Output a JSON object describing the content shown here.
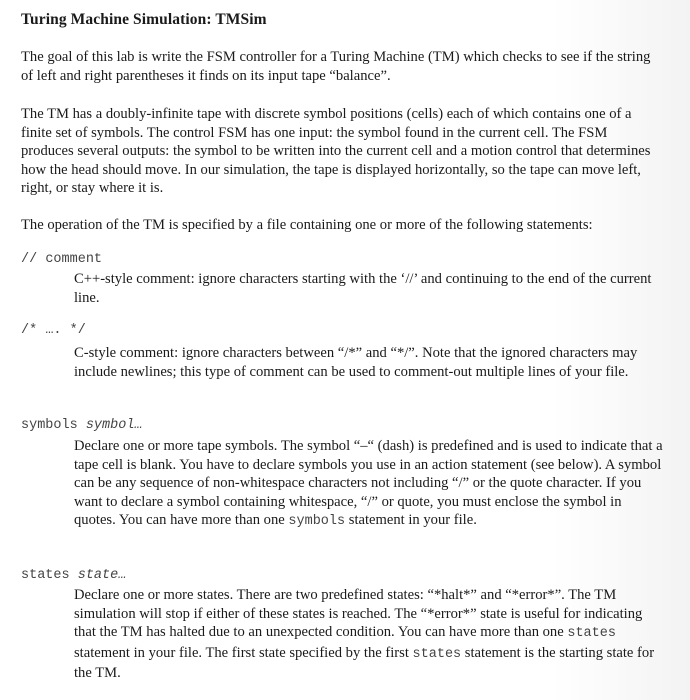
{
  "title": "Turing Machine Simulation: TMSim",
  "intro": "The goal of this lab is write the FSM controller for a Turing Machine (TM) which checks to see if the string of left and right parentheses it finds on its input tape “balance”.",
  "tape_paragraph": "The TM has a doubly-infinite tape with discrete symbol positions (cells) each of which contains one of a finite set of symbols.   The control FSM has one input: the symbol found in the current cell.  The FSM produces several outputs: the symbol to be written into the current cell and a motion control that determines how the head should move.  In our simulation, the tape is displayed horizontally, so the tape can move left, right, or stay where it is.",
  "operation_paragraph": "The operation of the TM is specified by a file containing one or more of the following statements:",
  "statements": [
    {
      "term_keyword": "// ",
      "term_arg": "comment",
      "description": "C++-style comment: ignore characters starting with the ‘//’ and continuing to the end of the current line."
    },
    {
      "term_keyword": "/* ",
      "term_arg": " ….   */",
      "description": "C-style comment: ignore characters between “/*” and “*/”.  Note that the ignored characters may include newlines; this type of comment can be used to comment-out multiple lines of your file."
    },
    {
      "term_keyword": "symbols ",
      "term_arg": "symbol…",
      "description_parts": [
        "Declare one or more tape symbols.  The symbol “–“ (dash) is predefined and is used to indicate that a tape cell is blank.  You have to declare symbols you use in an action statement (see below).  A symbol can be any sequence of non-whitespace characters not including “/” or the quote character.  If you want to declare a symbol containing whitespace, “/” or quote, you must enclose the symbol in quotes.  You can have more than one ",
        "symbols",
        " statement in your file."
      ]
    },
    {
      "term_keyword": "states ",
      "term_arg": "state…",
      "description_parts": [
        "Declare one or more states.  There are two predefined states: “*halt*” and “*error*”.  The TM simulation will stop if either of these states is reached.   The “*error*” state is useful for indicating that the TM has halted due to an unexpected condition.  You can have more than one ",
        "states",
        " statement in your file.  The first state specified by the first ",
        "states",
        " statement is the starting state for the TM."
      ]
    }
  ]
}
